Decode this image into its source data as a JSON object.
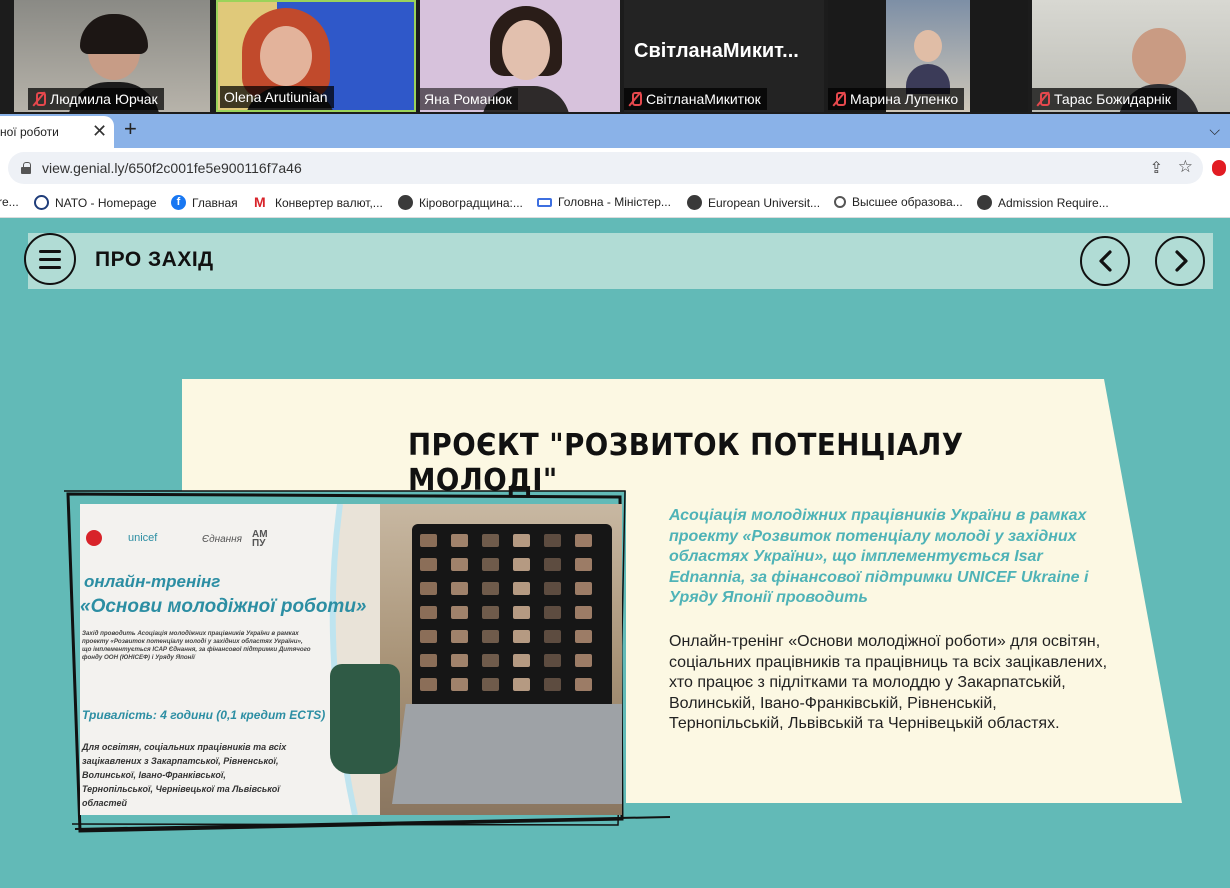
{
  "participants": [
    {
      "name": "Людмила Юрчак",
      "muted": true
    },
    {
      "name": "Olena Arutiunian",
      "muted": false
    },
    {
      "name": "Яна Романюк",
      "muted": false
    },
    {
      "name": "СвітланаМикитюк",
      "muted": true,
      "display_name": "СвітланаМикит..."
    },
    {
      "name": "Марина Лупенко",
      "muted": true
    },
    {
      "name": "Тарас Божидарнік",
      "muted": true
    }
  ],
  "browser": {
    "tab_title": "ної роботи",
    "tab_close": "✕",
    "new_tab": "+",
    "tab_menu": "⌵",
    "url": "view.genial.ly/650f2c001fe5e900116f7a46",
    "share_icon": "⇪",
    "star_icon": "☆",
    "bookmarks": [
      {
        "label": "re...",
        "icon": "globe-icon"
      },
      {
        "label": "NATO - Homepage",
        "icon": "nato-icon"
      },
      {
        "label": "Главная",
        "icon": "facebook-icon"
      },
      {
        "label": "Конвертер валют,...",
        "icon": "m-icon"
      },
      {
        "label": "Кіровоградщина:...",
        "icon": "globe-icon"
      },
      {
        "label": "Головна - Міністер...",
        "icon": "dots-icon"
      },
      {
        "label": "European Universit...",
        "icon": "globe-icon"
      },
      {
        "label": "Высшее образова...",
        "icon": "gender-icon"
      },
      {
        "label": "Admission Require...",
        "icon": "globe-icon"
      }
    ]
  },
  "page": {
    "section_title": "ПРО ЗАХІД",
    "title": "ПРОЄКТ \"РОЗВИТОК ПОТЕНЦІАЛУ МОЛОДІ\"",
    "intro": "Асоціація молодіжних працівників України в рамках проекту «Розвиток потенціалу молоді у західних областях України», що імплементується Isar Ednannia, за фінансової підтримки UNICEF Ukraine і Уряду Японії проводить",
    "description": "Онлайн-тренінг «Основи молодіжної роботи» для освітян, соціальних працівників та працівниць та всіх зацікавлених, хто працює з підлітками та молоддю у Закарпатській, Волинській, Івано-Франківській, Рівненській, Тернопільській, Львівській та Чернівецькій областях."
  },
  "poster": {
    "unicef": "unicef",
    "ednannia": "Єднання",
    "amu": "АМ\nПУ",
    "type": "онлайн-тренінг",
    "name": "«Основи молодіжної роботи»",
    "small_text": "Захід проводить Асоціація молодіжних працівників України в рамках проекту «Розвиток потенціалу молоді у західних областях України», що імплементується ІСАР Єднання, за фінансової підтримки Дитячого фонду ООН (ЮНІСЕФ) і Уряду Японії",
    "duration": "Тривалість: 4 години (0,1 кредит ECTS)",
    "audience": "Для освітян, соціальних працівників та всіх зацікавлених з Закарпатської, Рівненської, Волинської, Івано-Франківської, Тернопільської, Чернівецької та Львівської областей"
  },
  "colors": {
    "page_bg": "#62bab7",
    "band": "#b1dcd5",
    "card": "#fcf8e3",
    "accent_text": "#4fb3b7"
  }
}
